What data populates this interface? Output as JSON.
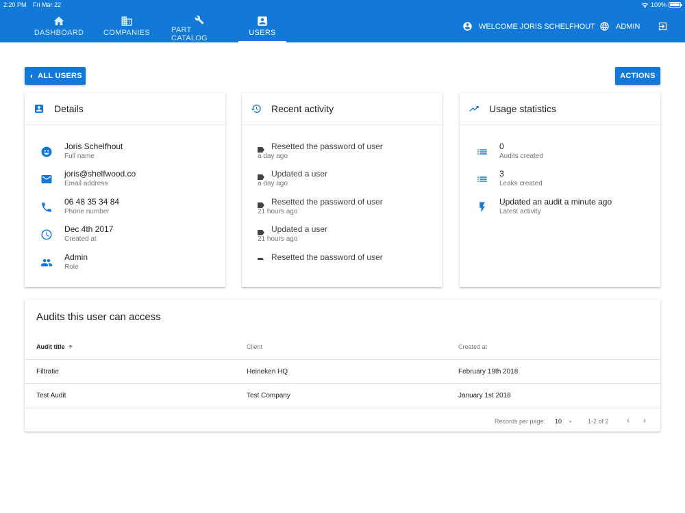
{
  "status_bar": {
    "time": "2:20 PM",
    "date": "Fri Mar 22",
    "battery": "100%"
  },
  "nav": {
    "tabs": [
      {
        "label": "DASHBOARD",
        "icon": "home-icon"
      },
      {
        "label": "COMPANIES",
        "icon": "building-icon"
      },
      {
        "label": "PART CATALOG",
        "icon": "wrench-icon"
      },
      {
        "label": "USERS",
        "icon": "user-badge-icon",
        "active": true
      }
    ],
    "welcome": "WELCOME JORIS SCHELFHOUT",
    "role": "ADMIN"
  },
  "toolbar": {
    "back_label": "ALL USERS",
    "actions_label": "ACTIONS"
  },
  "details": {
    "title": "Details",
    "items": [
      {
        "value": "Joris Schelfhout",
        "label": "Full name",
        "icon": "face-icon"
      },
      {
        "value": "joris@shelfwood.co",
        "label": "Email address",
        "icon": "mail-icon"
      },
      {
        "value": "06 48 35 34 84",
        "label": "Phone number",
        "icon": "phone-icon"
      },
      {
        "value": "Dec 4th 2017",
        "label": "Created at",
        "icon": "clock-icon"
      },
      {
        "value": "Admin",
        "label": "Role",
        "icon": "people-icon"
      }
    ]
  },
  "activity": {
    "title": "Recent activity",
    "items": [
      {
        "text": "Resetted the password of user",
        "time": "a day ago"
      },
      {
        "text": "Updated a user",
        "time": "a day ago"
      },
      {
        "text": "Resetted the password of user",
        "time": "21 hours ago"
      },
      {
        "text": "Updated a user",
        "time": "21 hours ago"
      },
      {
        "text": "Resetted the password of user",
        "time": ""
      }
    ]
  },
  "usage": {
    "title": "Usage statistics",
    "items": [
      {
        "value": "0",
        "label": "Audits created",
        "icon": "list-icon"
      },
      {
        "value": "3",
        "label": "Leaks created",
        "icon": "list-icon"
      },
      {
        "value": "Updated an audit a minute ago",
        "label": "Latest activity",
        "icon": "bolt-icon"
      }
    ]
  },
  "audits": {
    "title": "Audits this user can access",
    "columns": [
      "Audit title",
      "Client",
      "Created at"
    ],
    "rows": [
      [
        "Filtratie",
        "Heineken HQ",
        "February 19th 2018"
      ],
      [
        "Test Audit",
        "Test Company",
        "January 1st 2018"
      ]
    ],
    "records_per_page_label": "Records per page:",
    "records_per_page": "10",
    "range": "1-2 of 2"
  },
  "colors": {
    "primary": "#1279d8",
    "text": "#212121",
    "secondary_text": "#757575"
  }
}
